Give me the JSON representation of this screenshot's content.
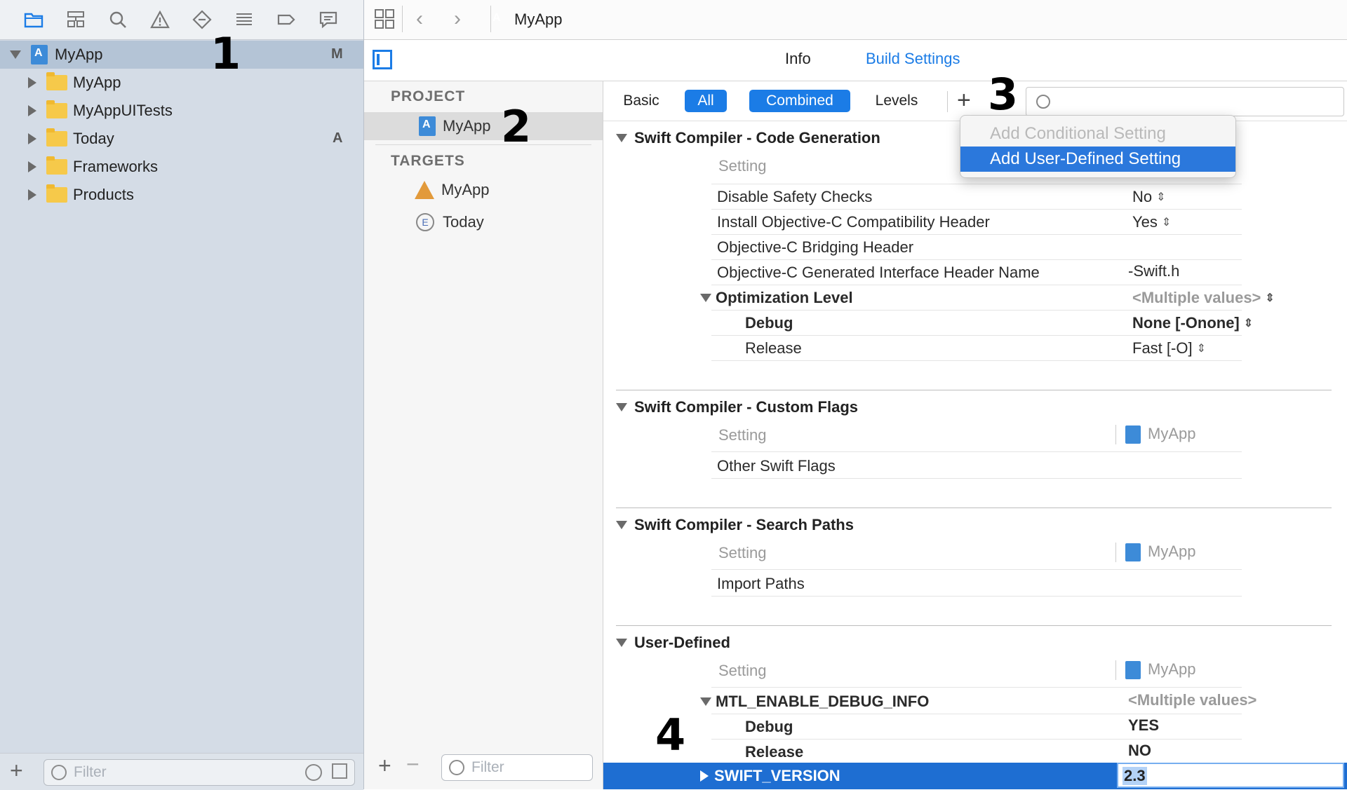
{
  "navigator": {
    "root": {
      "name": "MyApp",
      "badge": "M"
    },
    "items": [
      {
        "name": "MyApp",
        "badge": ""
      },
      {
        "name": "MyAppUITests",
        "badge": ""
      },
      {
        "name": "Today",
        "badge": "A"
      },
      {
        "name": "Frameworks",
        "badge": ""
      },
      {
        "name": "Products",
        "badge": ""
      }
    ],
    "filter_placeholder": "Filter"
  },
  "topbar": {
    "breadcrumb": "MyApp"
  },
  "tabs": {
    "info": "Info",
    "build_settings": "Build Settings"
  },
  "targets_pane": {
    "project_header": "PROJECT",
    "project_item": "MyApp",
    "targets_header": "TARGETS",
    "targets": [
      "MyApp",
      "Today"
    ],
    "filter_placeholder": "Filter"
  },
  "filterbar": {
    "basic": "Basic",
    "all": "All",
    "combined": "Combined",
    "levels": "Levels",
    "add": "+"
  },
  "popup": {
    "item1": "Add Conditional Setting",
    "item2": "Add User-Defined Setting"
  },
  "groups": {
    "codegen": {
      "title": "Swift Compiler - Code Generation",
      "setting_header": "Setting",
      "rows": [
        {
          "name": "Disable Safety Checks",
          "value": "No"
        },
        {
          "name": "Install Objective-C Compatibility Header",
          "value": "Yes"
        },
        {
          "name": "Objective-C Bridging Header",
          "value": ""
        },
        {
          "name": "Objective-C Generated Interface Header Name",
          "value": "-Swift.h"
        }
      ],
      "opt": {
        "name": "Optimization Level",
        "value": "<Multiple values>",
        "debug": {
          "name": "Debug",
          "value": "None [-Onone]"
        },
        "release": {
          "name": "Release",
          "value": "Fast [-O]"
        }
      }
    },
    "custom": {
      "title": "Swift Compiler - Custom Flags",
      "setting_header": "Setting",
      "col": "MyApp",
      "row": "Other Swift Flags"
    },
    "search": {
      "title": "Swift Compiler - Search Paths",
      "setting_header": "Setting",
      "col": "MyApp",
      "row": "Import Paths"
    },
    "user": {
      "title": "User-Defined",
      "setting_header": "Setting",
      "col": "MyApp",
      "mtl": {
        "name": "MTL_ENABLE_DEBUG_INFO",
        "value": "<Multiple values>",
        "debug": {
          "name": "Debug",
          "value": "YES"
        },
        "release": {
          "name": "Release",
          "value": "NO"
        }
      },
      "swift_version": {
        "name": "SWIFT_VERSION",
        "value": "2.3"
      }
    }
  },
  "callouts": [
    "1",
    "2",
    "3",
    "4"
  ]
}
